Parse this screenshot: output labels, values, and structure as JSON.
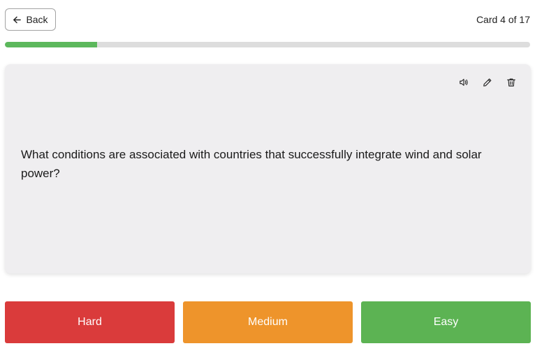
{
  "header": {
    "back_label": "Back",
    "counter": "Card 4 of 17"
  },
  "progress": {
    "current": 4,
    "total": 17,
    "fraction": 0.176,
    "fill_color": "#5cb85c",
    "track_color": "#dddddd"
  },
  "card": {
    "question": "What conditions are associated with countries that successfully integrate wind and solar power?",
    "actions": [
      "speaker-icon",
      "pencil-icon",
      "trash-icon"
    ]
  },
  "answers": [
    {
      "label": "Hard",
      "color": "#da3b3b"
    },
    {
      "label": "Medium",
      "color": "#ee942b"
    },
    {
      "label": "Easy",
      "color": "#5cb353"
    }
  ]
}
